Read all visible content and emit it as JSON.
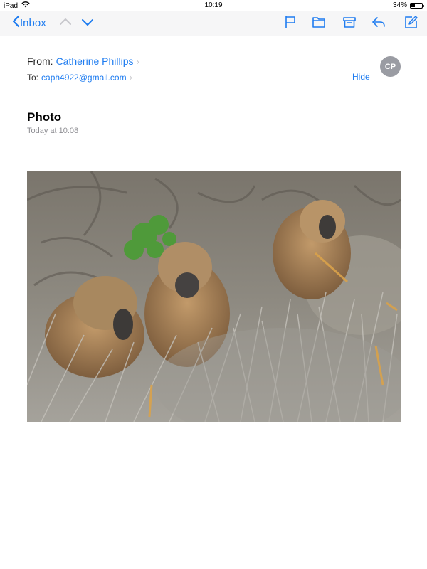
{
  "status": {
    "device": "iPad",
    "time": "10:19",
    "battery": "34%",
    "battery_level": 0.34
  },
  "toolbar": {
    "back_label": "Inbox",
    "icons": [
      "chevron-up-icon",
      "chevron-down-icon",
      "flag-icon",
      "folder-icon",
      "archive-icon",
      "reply-icon",
      "compose-icon"
    ]
  },
  "email": {
    "from_label": "From:",
    "from_name": "Catherine Phillips",
    "to_label": "To:",
    "to_address": "caph4922@gmail.com",
    "hide_label": "Hide",
    "avatar_initials": "CP",
    "subject": "Photo",
    "date": "Today at 10:08"
  },
  "colors": {
    "accent": "#1e7cf0",
    "toolbar_bg": "#f6f6f7",
    "avatar_bg": "#9a9ca3",
    "muted": "#8e8e93"
  }
}
